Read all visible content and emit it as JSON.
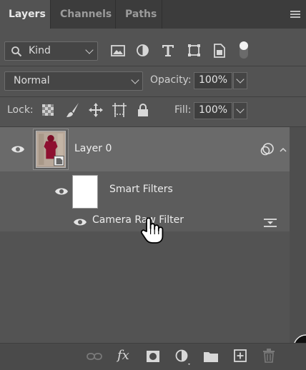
{
  "tabs": [
    {
      "label": "Layers"
    },
    {
      "label": "Channels"
    },
    {
      "label": "Paths"
    }
  ],
  "filter": {
    "kind_label": "Kind"
  },
  "blend": {
    "mode": "Normal",
    "opacity_label": "Opacity:",
    "opacity_value": "100%"
  },
  "lock": {
    "label": "Lock:",
    "fill_label": "Fill:",
    "fill_value": "100%"
  },
  "layers": {
    "layer0_name": "Layer 0",
    "smart_filters_label": "Smart Filters",
    "filter_name": "Camera Raw Filter"
  },
  "bottom": {
    "fx_label": "fx"
  },
  "colors": {
    "accent_red": "#8e1030",
    "panel_bg": "#535353",
    "selected_row": "#6a6a6a"
  }
}
